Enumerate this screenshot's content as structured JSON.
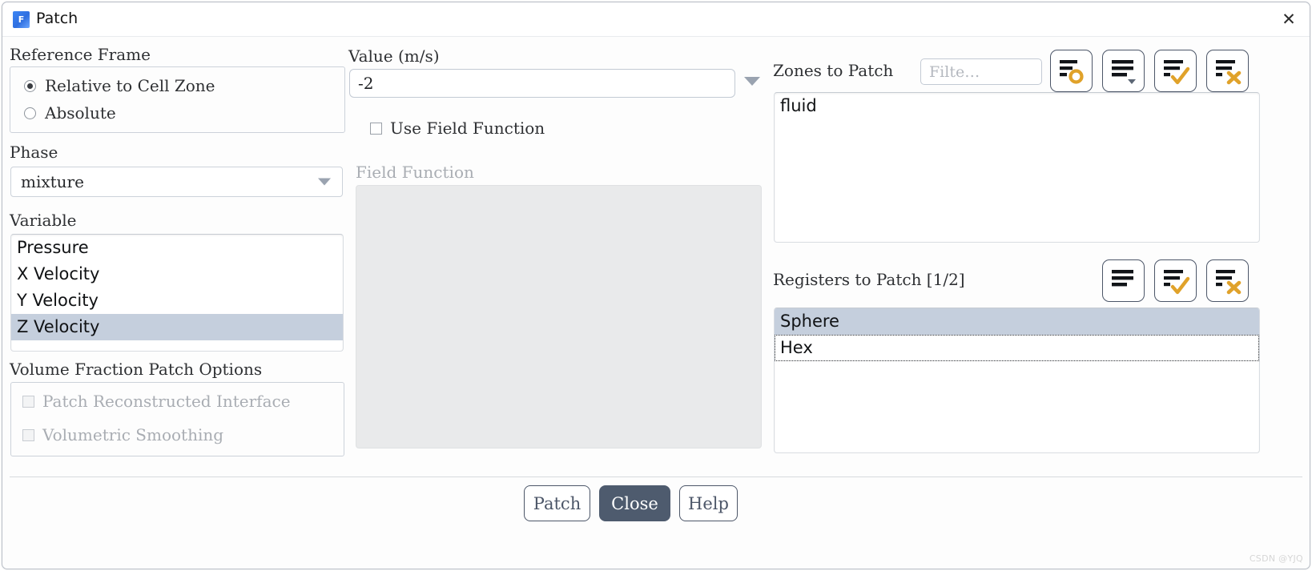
{
  "window": {
    "title": "Patch",
    "logo_letter": "F",
    "close_icon": "close-icon"
  },
  "reference_frame": {
    "label": "Reference Frame",
    "options": [
      {
        "label": "Relative to Cell Zone",
        "selected": true
      },
      {
        "label": "Absolute",
        "selected": false
      }
    ]
  },
  "phase": {
    "label": "Phase",
    "value": "mixture"
  },
  "variable": {
    "label": "Variable",
    "items": [
      {
        "label": "Pressure",
        "selected": false
      },
      {
        "label": "X Velocity",
        "selected": false
      },
      {
        "label": "Y Velocity",
        "selected": false
      },
      {
        "label": "Z Velocity",
        "selected": true
      }
    ]
  },
  "volume_fraction": {
    "label": "Volume Fraction Patch Options",
    "options": [
      {
        "label": "Patch Reconstructed Interface",
        "checked": false,
        "disabled": true
      },
      {
        "label": "Volumetric Smoothing",
        "checked": false,
        "disabled": true
      }
    ]
  },
  "value": {
    "label": "Value (m/s)",
    "text": "-2",
    "dropdown_icon": "chevron-down-icon"
  },
  "use_field_function": {
    "label": "Use Field Function",
    "checked": false
  },
  "field_function": {
    "label": "Field Function",
    "content": "",
    "disabled": true
  },
  "zones": {
    "label": "Zones to Patch",
    "filter_placeholder": "Filte…",
    "filter_value": "",
    "items": [
      {
        "label": "fluid",
        "selected": false
      }
    ],
    "toolbar": [
      {
        "name": "list-options-icon",
        "title": ""
      },
      {
        "name": "list-menu-dropdown-icon",
        "title": ""
      },
      {
        "name": "select-all-icon",
        "title": ""
      },
      {
        "name": "deselect-all-icon",
        "title": ""
      }
    ]
  },
  "registers": {
    "label": "Registers to Patch [1/2]",
    "items": [
      {
        "label": "Sphere",
        "selected": true,
        "focused": false
      },
      {
        "label": "Hex",
        "selected": false,
        "focused": true
      }
    ],
    "toolbar": [
      {
        "name": "list-menu-icon",
        "title": ""
      },
      {
        "name": "select-all-icon",
        "title": ""
      },
      {
        "name": "deselect-all-icon",
        "title": ""
      }
    ]
  },
  "footer": {
    "buttons": [
      {
        "label": "Patch",
        "primary": false
      },
      {
        "label": "Close",
        "primary": true
      },
      {
        "label": "Help",
        "primary": false
      }
    ]
  },
  "watermark": "CSDN @YJQ",
  "colors": {
    "accent_gold": "#e0a22a",
    "icon_dark": "#111418",
    "button_border": "#4c5668",
    "primary_button_bg": "#4e5b6e",
    "selection_bg": "#c5cfdd"
  }
}
